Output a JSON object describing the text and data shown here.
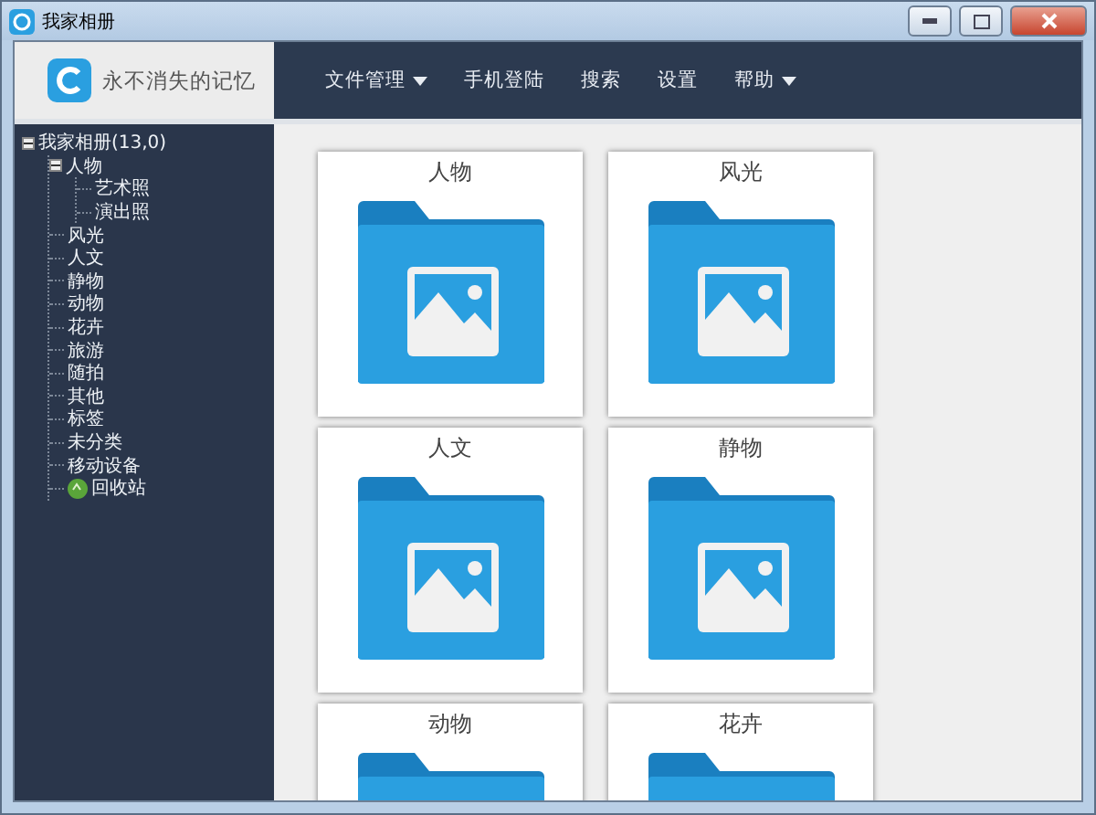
{
  "window": {
    "title": "我家相册"
  },
  "logo": {
    "text": "永不消失的记忆"
  },
  "nav": [
    {
      "label": "文件管理",
      "dropdown": true
    },
    {
      "label": "手机登陆",
      "dropdown": false
    },
    {
      "label": "搜索",
      "dropdown": false
    },
    {
      "label": "设置",
      "dropdown": false
    },
    {
      "label": "帮助",
      "dropdown": true
    }
  ],
  "tree": [
    {
      "label": "我家相册(13,0)",
      "kind": "folder",
      "expanded": true,
      "children": [
        {
          "label": "人物",
          "kind": "folder",
          "expanded": true,
          "children": [
            {
              "label": "艺术照",
              "kind": "folder"
            },
            {
              "label": "演出照",
              "kind": "folder"
            }
          ]
        },
        {
          "label": "风光",
          "kind": "folder"
        },
        {
          "label": "人文",
          "kind": "folder"
        },
        {
          "label": "静物",
          "kind": "folder"
        },
        {
          "label": "动物",
          "kind": "folder"
        },
        {
          "label": "花卉",
          "kind": "folder"
        },
        {
          "label": "旅游",
          "kind": "folder"
        },
        {
          "label": "随拍",
          "kind": "folder"
        },
        {
          "label": "其他",
          "kind": "folder"
        },
        {
          "label": "标签",
          "kind": "folder"
        },
        {
          "label": "未分类",
          "kind": "folder"
        },
        {
          "label": "移动设备",
          "kind": "folder"
        },
        {
          "label": "回收站",
          "kind": "recycle"
        }
      ]
    }
  ],
  "albums": [
    {
      "label": "人物"
    },
    {
      "label": "风光"
    },
    {
      "label": "人文"
    },
    {
      "label": "静物"
    },
    {
      "label": "动物"
    },
    {
      "label": "花卉"
    }
  ]
}
